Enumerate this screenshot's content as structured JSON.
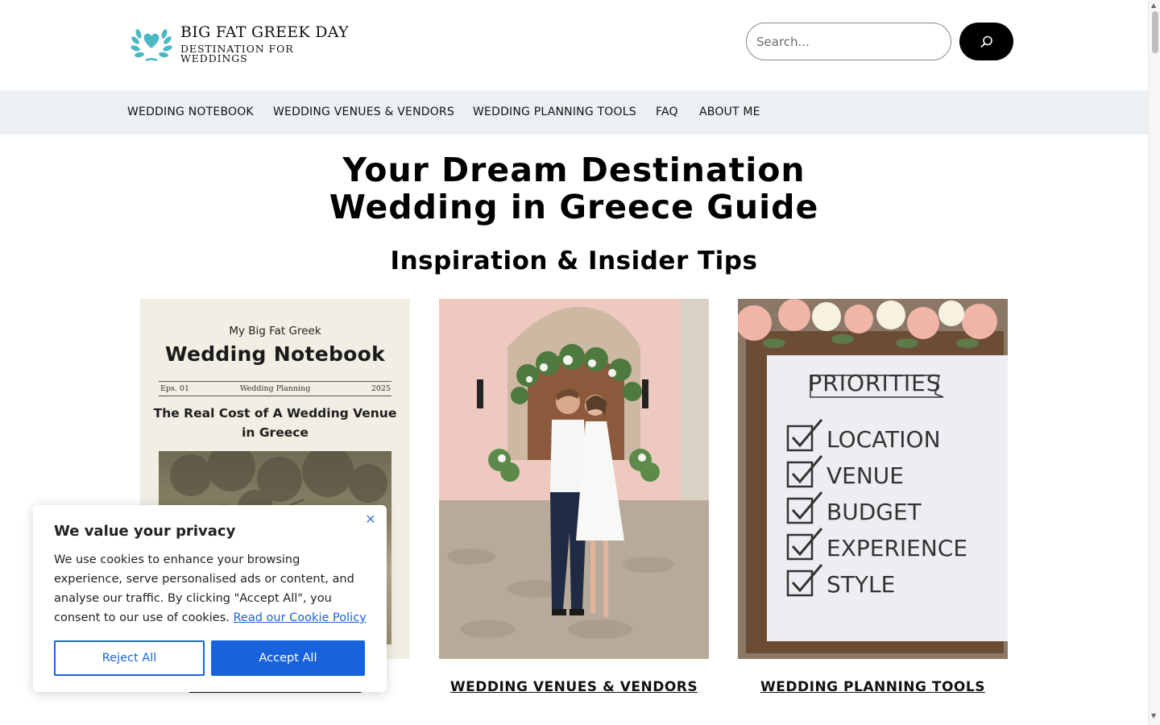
{
  "header": {
    "logo_title": "BIG FAT GREEK DAY",
    "logo_subtitle": "DESTINATION FOR WEDDINGS",
    "search_placeholder": "Search...",
    "brand_color": "#4bb8c4"
  },
  "nav": {
    "items": [
      {
        "label": "WEDDING NOTEBOOK"
      },
      {
        "label": "WEDDING VENUES & VENDORS"
      },
      {
        "label": "WEDDING PLANNING TOOLS"
      },
      {
        "label": "FAQ"
      },
      {
        "label": "ABOUT ME"
      }
    ]
  },
  "main": {
    "title_line1": "Your Dream Destination",
    "title_line2": "Wedding in Greece Guide",
    "section_title": "Inspiration & Insider Tips",
    "cards": [
      {
        "label": "WEDDING NOTEBOOK",
        "cover": {
          "pretitle": "My Big Fat Greek",
          "title": "Wedding Notebook",
          "meta_left": "Eps. 01",
          "meta_center": "Wedding Planning",
          "meta_right": "2025",
          "headline_line1": "The Real Cost of A Wedding Venue",
          "headline_line2": "in Greece"
        }
      },
      {
        "label": "WEDDING VENUES & VENDORS"
      },
      {
        "label": "WEDDING PLANNING TOOLS",
        "sign": {
          "title": "PRIORITIES",
          "items": [
            "LOCATION",
            "VENUE",
            "BUDGET",
            "EXPERIENCE",
            "STYLE"
          ]
        }
      }
    ]
  },
  "cookie_banner": {
    "title": "We value your privacy",
    "body": "We use cookies to enhance your browsing experience, serve personalised ads or content, and analyse our traffic. By clicking \"Accept All\", you consent to our use of cookies.",
    "link_text": "Read our Cookie Policy",
    "reject_label": "Reject All",
    "accept_label": "Accept All",
    "accent_color": "#1863dc"
  }
}
